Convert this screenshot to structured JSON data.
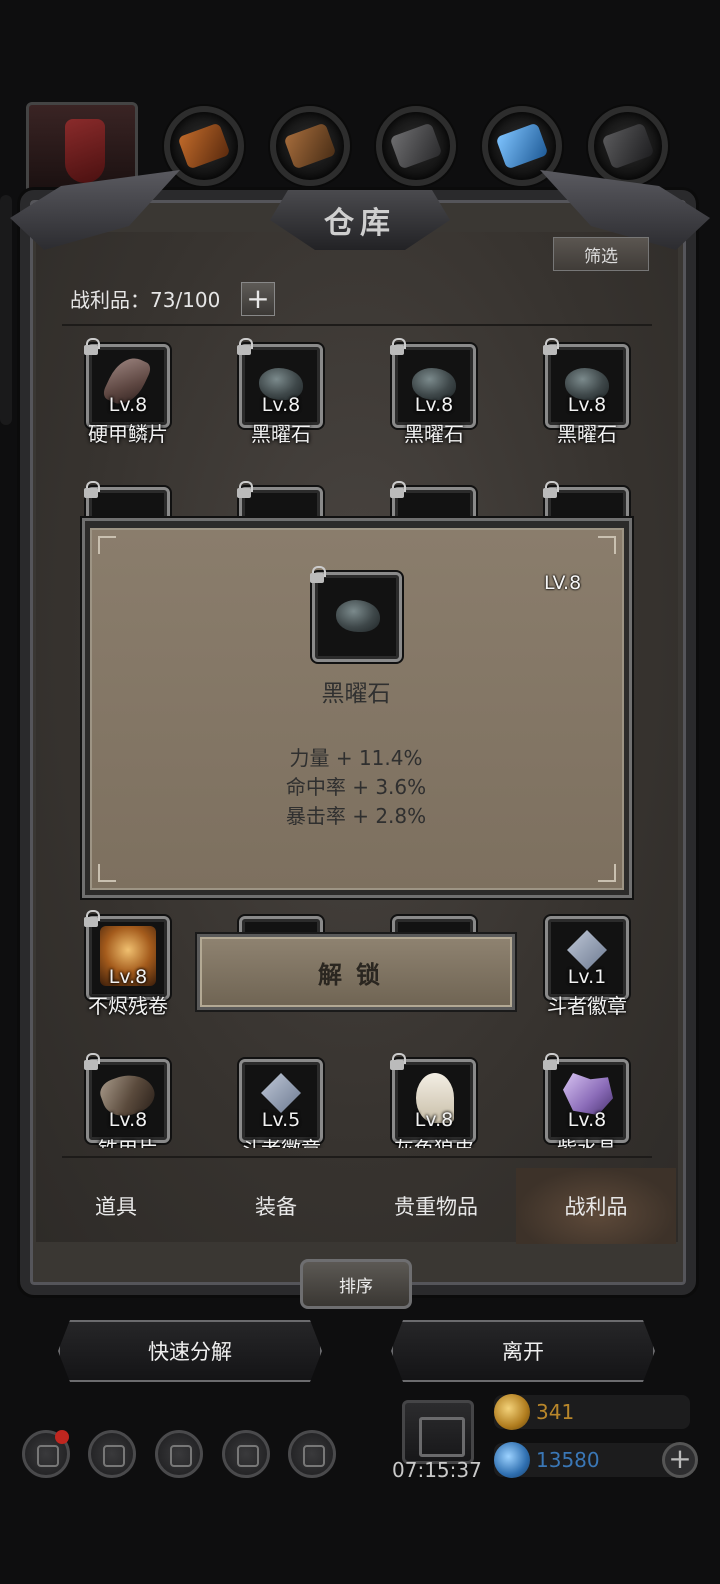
{
  "header": {
    "title": "仓库",
    "filter_label": "筛选",
    "loot_label": "战利品：73/100",
    "add_symbol": "+"
  },
  "category_icons": [
    {
      "name": "red-armor-icon",
      "color": "#6a1e1e"
    },
    {
      "name": "leather-icon",
      "color": "#8a4a1e"
    },
    {
      "name": "wood-planks-icon",
      "color": "#7a5030"
    },
    {
      "name": "iron-ingot-icon",
      "color": "#4a4a4c"
    },
    {
      "name": "blue-crystal-icon",
      "color": "#2f6fb0"
    },
    {
      "name": "dark-ingot-icon",
      "color": "#3a3a3c"
    }
  ],
  "items_row1": [
    {
      "lv": "Lv.8",
      "name": "硬甲鳞片",
      "icon": "scale-icon"
    },
    {
      "lv": "Lv.8",
      "name": "黑曜石",
      "icon": "obsidian-icon"
    },
    {
      "lv": "Lv.8",
      "name": "黑曜石",
      "icon": "obsidian-icon"
    },
    {
      "lv": "Lv.8",
      "name": "黑曜石",
      "icon": "obsidian-icon"
    }
  ],
  "items_row4": [
    {
      "lv": "Lv.8",
      "name": "不烬残卷",
      "icon": "scroll-icon"
    },
    {
      "lv": "Lv.1",
      "name": "斗者徽章",
      "icon": "badge-icon"
    }
  ],
  "items_row5": [
    {
      "lv": "Lv.8",
      "name": "铁甲片",
      "icon": "ore-icon"
    },
    {
      "lv": "Lv.5",
      "name": "斗者徽章",
      "icon": "badge-icon"
    },
    {
      "lv": "Lv.8",
      "name": "灰色狼皮",
      "icon": "fang-icon"
    },
    {
      "lv": "Lv.8",
      "name": "紫水晶",
      "icon": "crystal-icon"
    }
  ],
  "popup": {
    "lv": "LV.8",
    "item_name": "黑曜石",
    "stats": [
      "力量 + 11.4%",
      "命中率 + 3.6%",
      "暴击率 + 2.8%"
    ],
    "unlock_label": "解锁"
  },
  "tabs": [
    {
      "label": "道具",
      "active": false
    },
    {
      "label": "装备",
      "active": false
    },
    {
      "label": "贵重物品",
      "active": false
    },
    {
      "label": "战利品",
      "active": true
    }
  ],
  "sort_label": "排序",
  "actions": {
    "quick_decompose": "快速分解",
    "leave": "离开"
  },
  "status": {
    "clock": "07:15:37",
    "gold": "341",
    "gems": "13580",
    "gold_color": "#b8862a",
    "gem_color": "#3a77b6"
  }
}
